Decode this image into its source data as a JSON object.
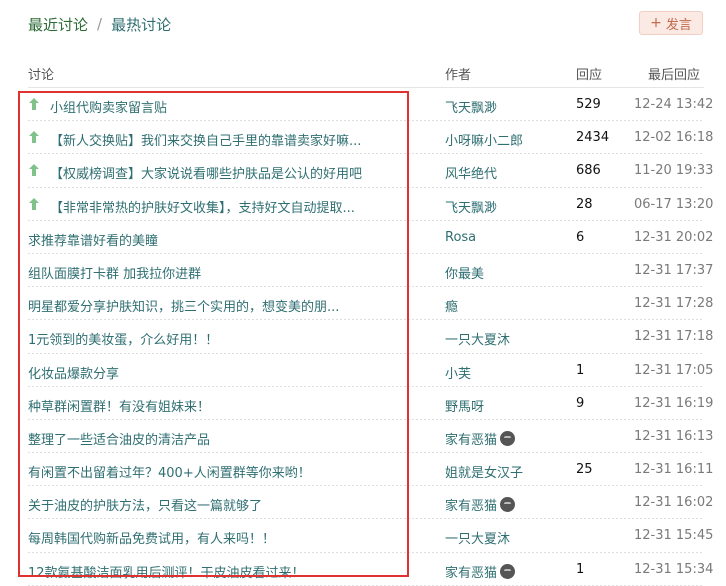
{
  "tabs": {
    "recent": "最近讨论",
    "separator": "/",
    "hot": "最热讨论"
  },
  "post_button": {
    "icon": "plus-icon",
    "label": "发言"
  },
  "table": {
    "headers": {
      "topic": "讨论",
      "author": "作者",
      "replies": "回应",
      "last_reply": "最后回应"
    },
    "rows": [
      {
        "pinned": true,
        "title": "小组代购卖家留言贴",
        "author": "飞天飘渺",
        "replies": "529",
        "time": "12-24 13:42",
        "avatar": false
      },
      {
        "pinned": true,
        "title": "【新人交换贴】我们来交换自己手里的靠谱卖家好嘛...",
        "author": "小呀嘛小二郎",
        "replies": "2434",
        "time": "12-02 16:18",
        "avatar": false
      },
      {
        "pinned": true,
        "title": "【权威榜调查】大家说说看哪些护肤品是公认的好用吧",
        "author": "风华绝代",
        "replies": "686",
        "time": "11-20 19:33",
        "avatar": false
      },
      {
        "pinned": true,
        "title": "【非常非常热的护肤好文收集】，支持好文自动提取...",
        "author": "飞天飘渺",
        "replies": "28",
        "time": "06-17 13:20",
        "avatar": false
      },
      {
        "pinned": false,
        "title": "求推荐靠谱好看的美瞳",
        "author": "Rosa",
        "replies": "6",
        "time": "12-31 20:02",
        "avatar": false
      },
      {
        "pinned": false,
        "title": "组队面膜打卡群 加我拉你进群",
        "author": "你最美",
        "replies": "",
        "time": "12-31 17:37",
        "avatar": false
      },
      {
        "pinned": false,
        "title": "明星都爱分享护肤知识，挑三个实用的，想变美的朋...",
        "author": "瘾",
        "replies": "",
        "time": "12-31 17:28",
        "avatar": false
      },
      {
        "pinned": false,
        "title": "1元领到的美妆蛋，介么好用！！",
        "author": "一只大夏沐",
        "replies": "",
        "time": "12-31 17:18",
        "avatar": false
      },
      {
        "pinned": false,
        "title": "化妆品爆款分享",
        "author": "小芙",
        "replies": "1",
        "time": "12-31 17:05",
        "avatar": false
      },
      {
        "pinned": false,
        "title": "种草群闲置群！有没有姐妹来！",
        "author": "野馬呀",
        "replies": "9",
        "time": "12-31 16:19",
        "avatar": false
      },
      {
        "pinned": false,
        "title": "整理了一些适合油皮的清洁产品",
        "author": "家有恶猫",
        "replies": "",
        "time": "12-31 16:13",
        "avatar": true
      },
      {
        "pinned": false,
        "title": "有闲置不出留着过年？400+人闲置群等你来哟！",
        "author": "姐就是女汉子",
        "replies": "25",
        "time": "12-31 16:11",
        "avatar": false
      },
      {
        "pinned": false,
        "title": "关于油皮的护肤方法，只看这一篇就够了",
        "author": "家有恶猫",
        "replies": "",
        "time": "12-31 16:02",
        "avatar": true
      },
      {
        "pinned": false,
        "title": "每周韩国代购新品免费试用，有人来吗！！",
        "author": "一只大夏沐",
        "replies": "",
        "time": "12-31 15:45",
        "avatar": false
      },
      {
        "pinned": false,
        "title": "12款氨基酸洁面乳用后测评！干皮油皮看过来！",
        "author": "家有恶猫",
        "replies": "1",
        "time": "12-31 15:34",
        "avatar": true
      }
    ]
  },
  "colors": {
    "link": "#2f6f72",
    "active_tab": "#2b6b34",
    "highlight_border": "#e03131",
    "pin_arrow": "#7fc28a",
    "post_button_bg": "#fbe9e3"
  }
}
